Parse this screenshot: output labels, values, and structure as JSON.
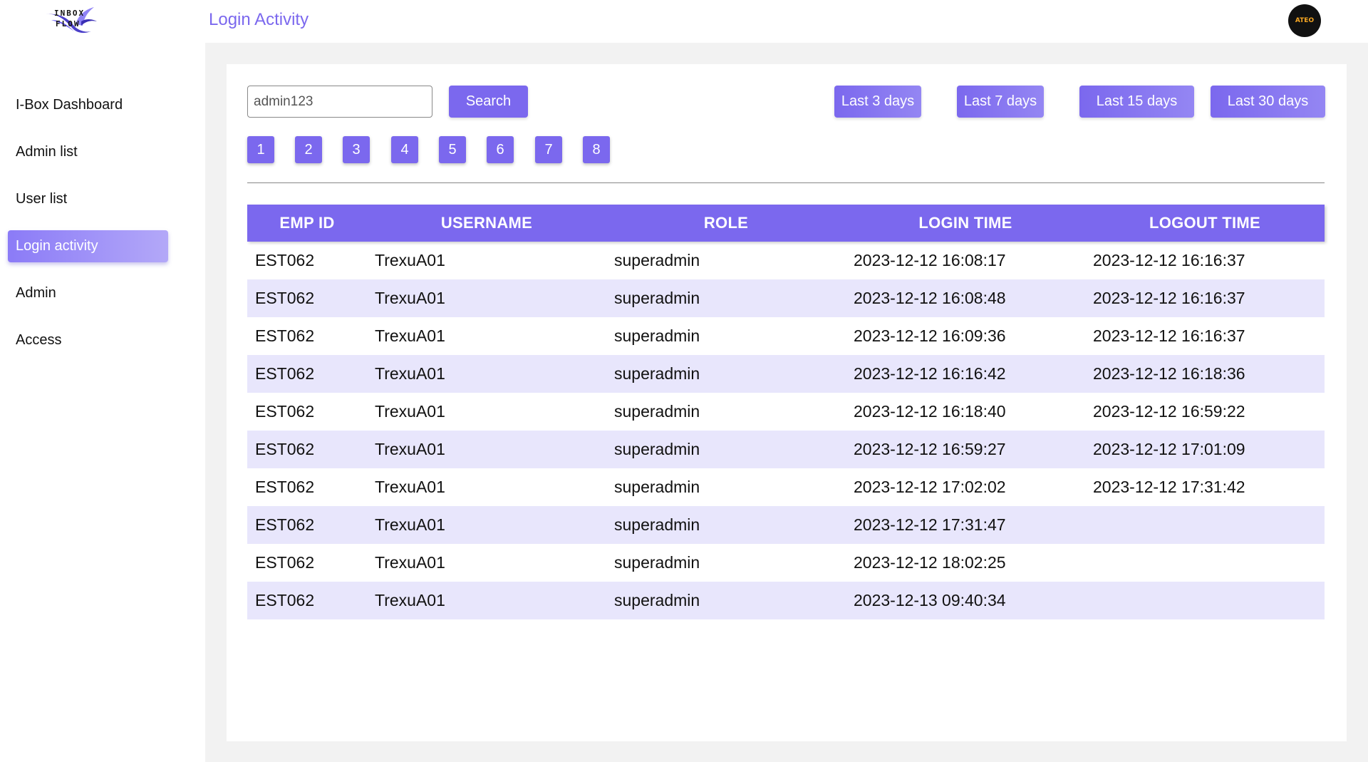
{
  "app": {
    "logo_line1": "INBOX",
    "logo_line2": "FLOW",
    "avatar_text": "ATEO",
    "accent_color": "#7b68ee"
  },
  "sidebar": {
    "items": [
      {
        "label": "I-Box Dashboard",
        "active": false
      },
      {
        "label": "Admin list",
        "active": false
      },
      {
        "label": "User list",
        "active": false
      },
      {
        "label": "Login activity",
        "active": true
      },
      {
        "label": "Admin",
        "active": false
      },
      {
        "label": "Access",
        "active": false
      }
    ]
  },
  "header": {
    "title": "Login Activity"
  },
  "search": {
    "value": "admin123",
    "button_label": "Search"
  },
  "ranges": [
    {
      "label": "Last 3 days"
    },
    {
      "label": "Last 7 days"
    },
    {
      "label": "Last 15 days"
    },
    {
      "label": "Last 30 days"
    }
  ],
  "pagination": [
    "1",
    "2",
    "3",
    "4",
    "5",
    "6",
    "7",
    "8"
  ],
  "table": {
    "columns": [
      "EMP ID",
      "USERNAME",
      "ROLE",
      "LOGIN TIME",
      "LOGOUT TIME"
    ],
    "rows": [
      [
        "EST062",
        "TrexuA01",
        "superadmin",
        "2023-12-12 16:08:17",
        "2023-12-12 16:16:37"
      ],
      [
        "EST062",
        "TrexuA01",
        "superadmin",
        "2023-12-12 16:08:48",
        "2023-12-12 16:16:37"
      ],
      [
        "EST062",
        "TrexuA01",
        "superadmin",
        "2023-12-12 16:09:36",
        "2023-12-12 16:16:37"
      ],
      [
        "EST062",
        "TrexuA01",
        "superadmin",
        "2023-12-12 16:16:42",
        "2023-12-12 16:18:36"
      ],
      [
        "EST062",
        "TrexuA01",
        "superadmin",
        "2023-12-12 16:18:40",
        "2023-12-12 16:59:22"
      ],
      [
        "EST062",
        "TrexuA01",
        "superadmin",
        "2023-12-12 16:59:27",
        "2023-12-12 17:01:09"
      ],
      [
        "EST062",
        "TrexuA01",
        "superadmin",
        "2023-12-12 17:02:02",
        "2023-12-12 17:31:42"
      ],
      [
        "EST062",
        "TrexuA01",
        "superadmin",
        "2023-12-12 17:31:47",
        ""
      ],
      [
        "EST062",
        "TrexuA01",
        "superadmin",
        "2023-12-12 18:02:25",
        ""
      ],
      [
        "EST062",
        "TrexuA01",
        "superadmin",
        "2023-12-13 09:40:34",
        ""
      ]
    ]
  }
}
